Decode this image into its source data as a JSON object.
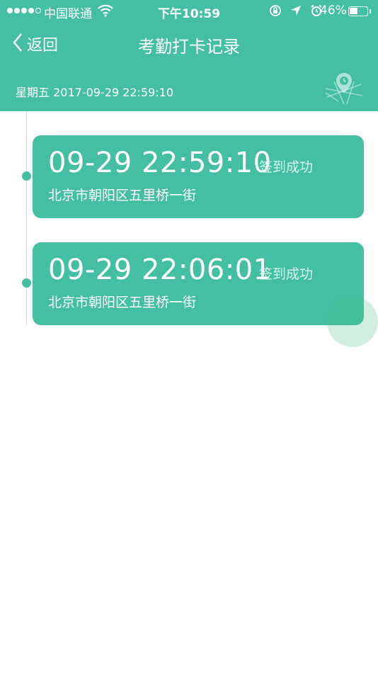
{
  "status_bar": {
    "carrier": "中国联通",
    "time": "下午10:59",
    "battery_percent": "46%",
    "battery_level": 0.46
  },
  "nav": {
    "back_label": "返回",
    "title": "考勤打卡记录"
  },
  "date_bar": {
    "text": "星期五 2017-09-29 22:59:10"
  },
  "records": [
    {
      "time": "09-29 22:59:10",
      "status": "签到成功",
      "address": "北京市朝阳区五里桥一街"
    },
    {
      "time": "09-29 22:06:01",
      "status": "签到成功",
      "address": "北京市朝阳区五里桥一街"
    }
  ],
  "colors": {
    "accent": "#44bfa3",
    "timeline": "#d8d8d8",
    "status_text": "#d7f3ea"
  },
  "icons": {
    "back": "chevron-left-icon",
    "map": "map-pin-clock-icon",
    "wifi": "wifi-icon",
    "lock_rotation": "rotation-lock-icon",
    "location": "location-arrow-icon",
    "alarm": "alarm-clock-icon",
    "battery": "battery-icon"
  }
}
